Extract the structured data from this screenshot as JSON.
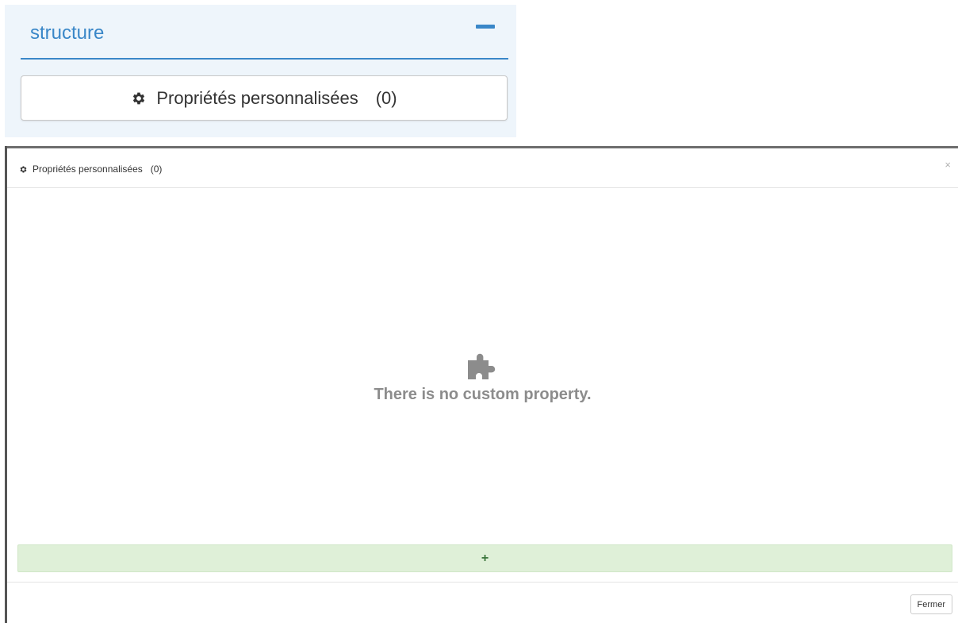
{
  "panel": {
    "title": "structure",
    "custom_props_button": {
      "label": "Propriétés personnalisées",
      "count": "(0)"
    }
  },
  "modal": {
    "title": "Propriétés personnalisées",
    "count": "(0)",
    "close_symbol": "×",
    "empty_message": "There is no custom property.",
    "add_label": "+",
    "footer_close_label": "Fermer"
  },
  "icons": {
    "collapse": "minus-icon",
    "gear": "gear-icon",
    "empty": "puzzle-piece-icon",
    "close": "close-icon"
  },
  "colors": {
    "accent": "#3a87c8",
    "panel_background": "#eef5fb",
    "add_button_background": "#dff0d8",
    "add_button_text": "#3c763d",
    "empty_text": "#8c8c8c"
  }
}
